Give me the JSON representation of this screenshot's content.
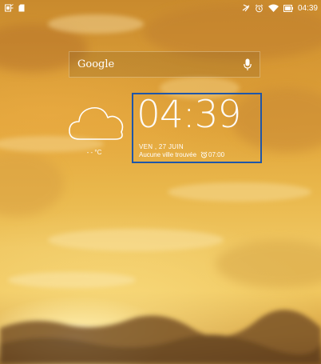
{
  "status_bar": {
    "time": "04:39",
    "icons": [
      "screenshot-icon",
      "sd-card-icon",
      "no-vibrate-icon",
      "alarm-icon",
      "wifi-icon",
      "battery-icon"
    ]
  },
  "search": {
    "label": "Google",
    "icon": "microphone-icon"
  },
  "weather": {
    "icon": "cloud-icon",
    "temperature": "- - °C"
  },
  "clock": {
    "time": "04:39",
    "date": "VEN , 27 JUIN",
    "location": "Aucune ville trouvée",
    "alarm": "07:00"
  },
  "colors": {
    "accent_border": "#1f56a8",
    "text": "#ffffff"
  }
}
